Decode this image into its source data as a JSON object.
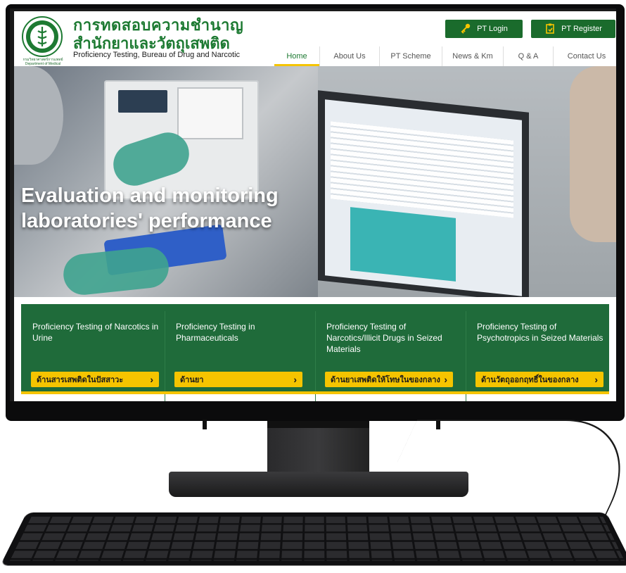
{
  "header": {
    "title_th_line1": "การทดสอบความชำนาญ",
    "title_th_line2": "สำนักยาและวัตถุเสพติด",
    "subtitle_en": "Proficiency Testing, Bureau of Drug and Narcotic",
    "logo_caption": "กรมวิทยาศาสตร์การแพทย์ Department of Medical Sciences",
    "login_label": "PT Login",
    "register_label": "PT Register",
    "accent_color": "#1d7a32"
  },
  "nav": {
    "items": [
      {
        "label": "Home",
        "active": true
      },
      {
        "label": "About Us",
        "active": false
      },
      {
        "label": "PT Scheme",
        "active": false
      },
      {
        "label": "News & Km",
        "active": false
      },
      {
        "label": "Q & A",
        "active": false
      },
      {
        "label": "Contact Us",
        "active": false
      }
    ]
  },
  "hero": {
    "text": "Evaluation and monitoring laboratories' performance"
  },
  "cards": [
    {
      "title": "Proficiency Testing of Narcotics in Urine",
      "button": "ด้านสารเสพติดในปัสสาวะ"
    },
    {
      "title": "Proficiency Testing in Pharmaceuticals",
      "button": "ด้านยา"
    },
    {
      "title": "Proficiency Testing of Narcotics/Illicit Drugs in Seized Materials",
      "button": "ด้านยาเสพติดให้โทษในของกลาง"
    },
    {
      "title": "Proficiency Testing of Psychotropics in Seized Materials",
      "button": "ด้านวัตถุออกฤทธิ์ในของกลาง"
    }
  ],
  "colors": {
    "green": "#1f6b3a",
    "yellow": "#f5c400"
  }
}
